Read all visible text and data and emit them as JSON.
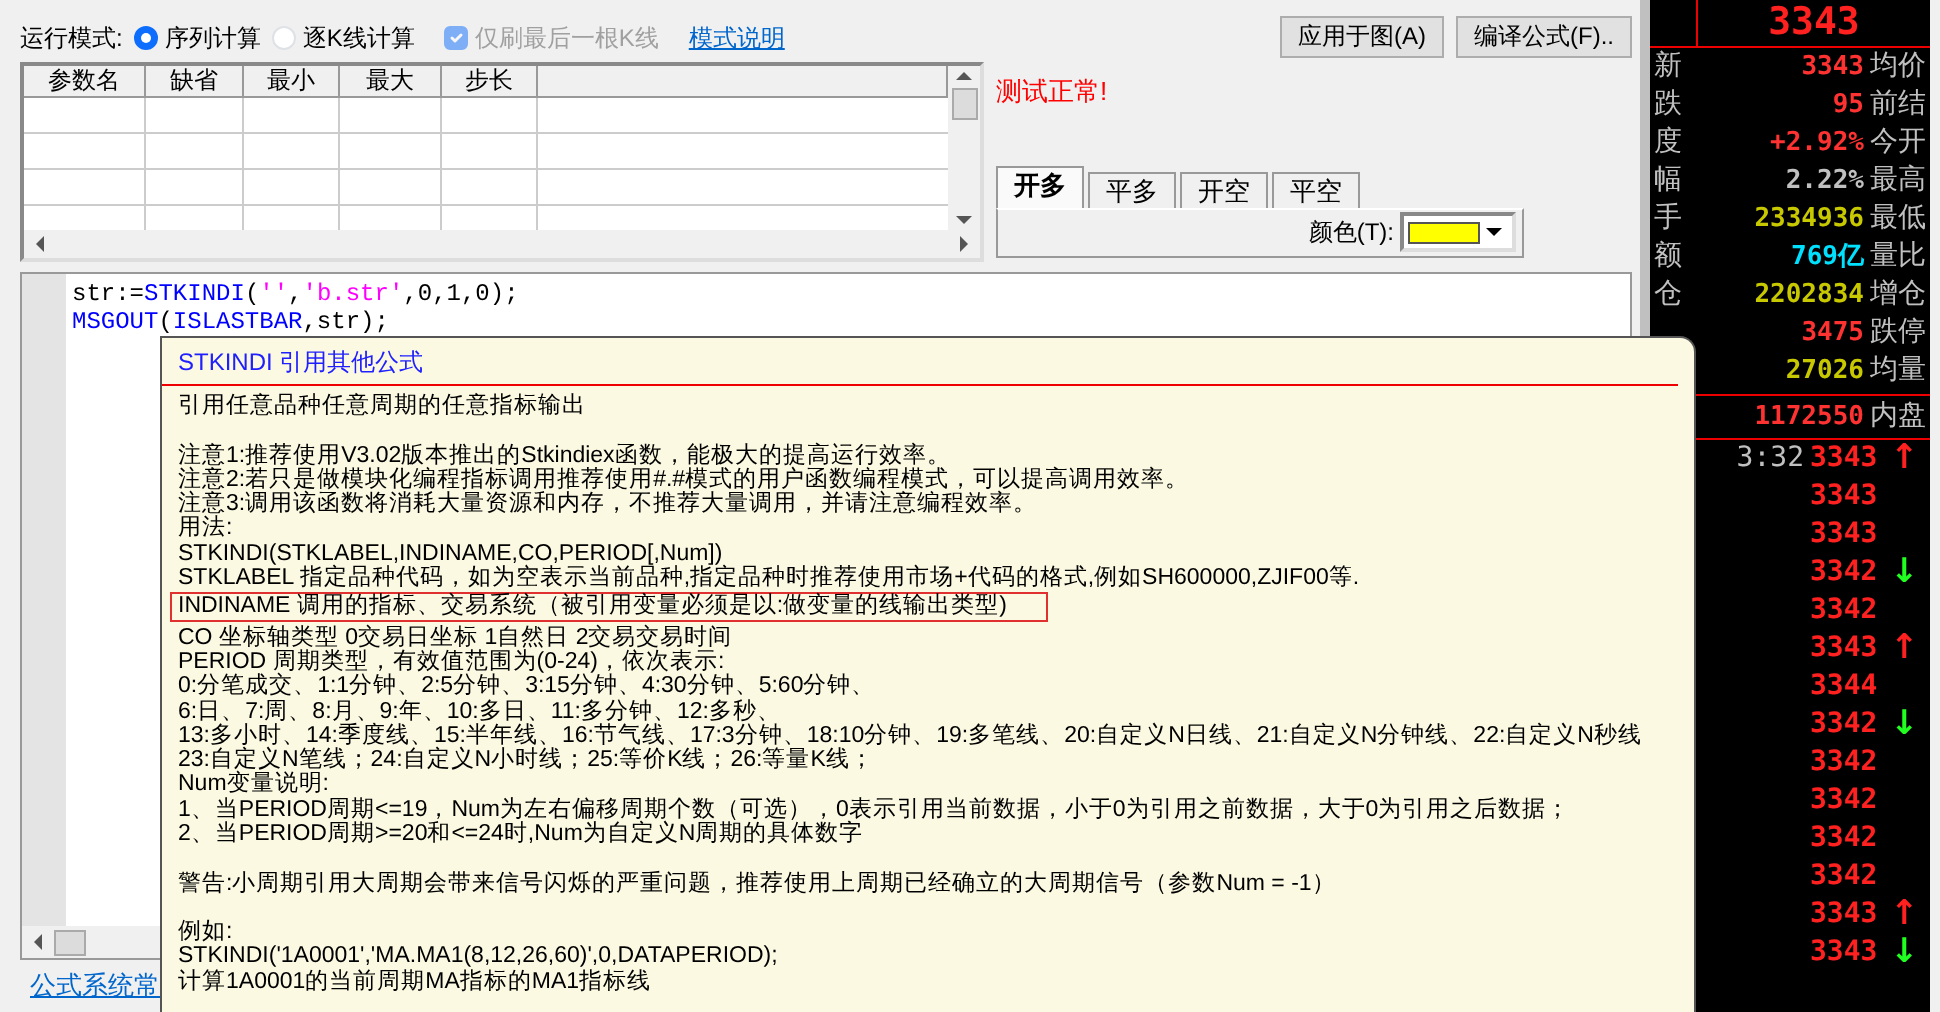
{
  "mode": {
    "label": "运行模式:",
    "options": [
      {
        "label": "序列计算",
        "selected": true
      },
      {
        "label": "逐K线计算",
        "selected": false
      }
    ],
    "refresh_last_bar": {
      "label": "仅刷最后一根K线",
      "checked": true,
      "disabled": true
    },
    "help_link": "模式说明"
  },
  "buttons": [
    "应用于图(A)",
    "编译公式(F).."
  ],
  "params_table": {
    "columns": [
      "参数名",
      "缺省",
      "最小",
      "最大",
      "步长"
    ]
  },
  "test_status": "测试正常!",
  "tabs": [
    {
      "label": "开多",
      "selected": true
    },
    {
      "label": "平多",
      "selected": false
    },
    {
      "label": "开空",
      "selected": false
    },
    {
      "label": "平空",
      "selected": false
    }
  ],
  "color_field": {
    "label": "颜色(T):",
    "color": "#ffff00"
  },
  "editor": {
    "lines": [
      [
        {
          "text": "str:=",
          "kind": "plain"
        },
        {
          "text": "STKINDI",
          "kind": "function"
        },
        {
          "text": "(",
          "kind": "plain"
        },
        {
          "text": "''",
          "kind": "string"
        },
        {
          "text": ",",
          "kind": "plain"
        },
        {
          "text": "'b.str'",
          "kind": "string"
        },
        {
          "text": ",0,1,0);",
          "kind": "plain"
        }
      ],
      [
        {
          "text": "MSGOUT",
          "kind": "function"
        },
        {
          "text": "(",
          "kind": "plain"
        },
        {
          "text": "ISLASTBAR",
          "kind": "function"
        },
        {
          "text": ",str);",
          "kind": "plain"
        }
      ]
    ]
  },
  "bottom_link": "公式系统常",
  "tooltip": {
    "title": "STKINDI  引用其他公式",
    "paragraphs": [
      {
        "lines": [
          {
            "text": "引用任意品种任意周期的任意指标输出",
            "boxed": false
          }
        ]
      },
      {
        "lines": [
          {
            "text": "注意1:推荐使用V3.02版本推出的Stkindiex函数，能极大的提高运行效率。",
            "boxed": false
          },
          {
            "text": "注意2:若只是做模块化编程指标调用推荐使用#.#模式的用户函数编程模式，可以提高调用效率。",
            "boxed": false
          },
          {
            "text": "注意3:调用该函数将消耗大量资源和内存，不推荐大量调用，并请注意编程效率。",
            "boxed": false
          },
          {
            "text": "用法:",
            "boxed": false
          },
          {
            "text": "STKINDI(STKLABEL,INDINAME,CO,PERIOD[,Num])",
            "boxed": false
          },
          {
            "text": "STKLABEL 指定品种代码，如为空表示当前品种,指定品种时推荐使用市场+代码的格式,例如SH600000,ZJIF00等.",
            "boxed": false
          },
          {
            "text": "INDINAME 调用的指标、交易系统（被引用变量必须是以:做变量的线输出类型)",
            "boxed": true
          },
          {
            "text": "CO 坐标轴类型 0交易日坐标 1自然日 2交易交易时间",
            "boxed": false
          },
          {
            "text": "PERIOD 周期类型，有效值范围为(0-24)，依次表示:",
            "boxed": false
          },
          {
            "text": "0:分笔成交、1:1分钟、2:5分钟、3:15分钟、4:30分钟、5:60分钟、",
            "boxed": false
          },
          {
            "text": "6:日、7:周、8:月、9:年、10:多日、11:多分钟、12:多秒、",
            "boxed": false
          },
          {
            "text": "13:多小时、14:季度线、15:半年线、16:节气线、17:3分钟、18:10分钟、19:多笔线、20:自定义N日线、21:自定义N分钟线、22:自定义N秒线",
            "boxed": false
          },
          {
            "text": "23:自定义N笔线；24:自定义N小时线；25:等价K线；26:等量K线；",
            "boxed": false
          },
          {
            "text": "Num变量说明:",
            "boxed": false
          },
          {
            "text": "1、当PERIOD周期<=19，Num为左右偏移周期个数（可选），0表示引用当前数据，小于0为引用之前数据，大于0为引用之后数据；",
            "boxed": false
          },
          {
            "text": "2、当PERIOD周期>=20和<=24时,Num为自定义N周期的具体数字",
            "boxed": false
          }
        ]
      },
      {
        "lines": [
          {
            "text": "警告:小周期引用大周期会带来信号闪烁的严重问题，推荐使用上周期已经确立的大周期信号（参数Num = -1）",
            "boxed": false
          }
        ]
      },
      {
        "lines": [
          {
            "text": "例如:",
            "boxed": false
          },
          {
            "text": "STKINDI('1A0001','MA.MA1(8,12,26,60)',0,DATAPERIOD);",
            "boxed": false
          },
          {
            "text": "计算1A0001的当前周期MA指标的MA1指标线",
            "boxed": false
          }
        ]
      }
    ]
  },
  "quote_panel": {
    "last_price": "3343",
    "rows": [
      {
        "label": "新",
        "value": "3343",
        "color": "#ff3232",
        "field": "均价"
      },
      {
        "label": "跌",
        "value": "95",
        "color": "#ff3232",
        "field": "前结"
      },
      {
        "label": "度",
        "value": "+2.92%",
        "color": "#ff3232",
        "field": "今开"
      },
      {
        "label": "幅",
        "value": "2.22%",
        "color": "#c0c0c0",
        "field": "最高"
      },
      {
        "label": "手",
        "value": "2334936",
        "color": "#c8c800",
        "field": "最低"
      },
      {
        "label": "额",
        "value": "769亿",
        "color": "#00e0ff",
        "field": "量比"
      },
      {
        "label": "仓",
        "value": "2202834",
        "color": "#c8c800",
        "field": "增仓"
      },
      {
        "value": "3475",
        "color": "#ff3232",
        "field": "跌停"
      },
      {
        "value": "27026",
        "color": "#c8c800",
        "field": "均量"
      }
    ],
    "totals": [
      {
        "value": "1172550",
        "color": "#ff3232",
        "field": "内盘"
      }
    ],
    "ticks": [
      {
        "time": "3:32",
        "price": "3343",
        "arrow": "↑",
        "color": "#ff2020"
      },
      {
        "price": "3343"
      },
      {
        "price": "3343"
      },
      {
        "price": "3342",
        "arrow": "↓",
        "color": "#20ff20"
      },
      {
        "price": "3342"
      },
      {
        "price": "3343",
        "arrow": "↑",
        "color": "#ff2020"
      },
      {
        "price": "3344"
      },
      {
        "price": "3342",
        "arrow": "↓",
        "color": "#20ff20"
      },
      {
        "price": "3342"
      },
      {
        "price": "3342"
      },
      {
        "price": "3342"
      },
      {
        "price": "3342"
      },
      {
        "price": "3343",
        "arrow": "↑",
        "color": "#ff2020"
      },
      {
        "price": "3343",
        "arrow": "↓",
        "color": "#20ff20"
      }
    ]
  }
}
